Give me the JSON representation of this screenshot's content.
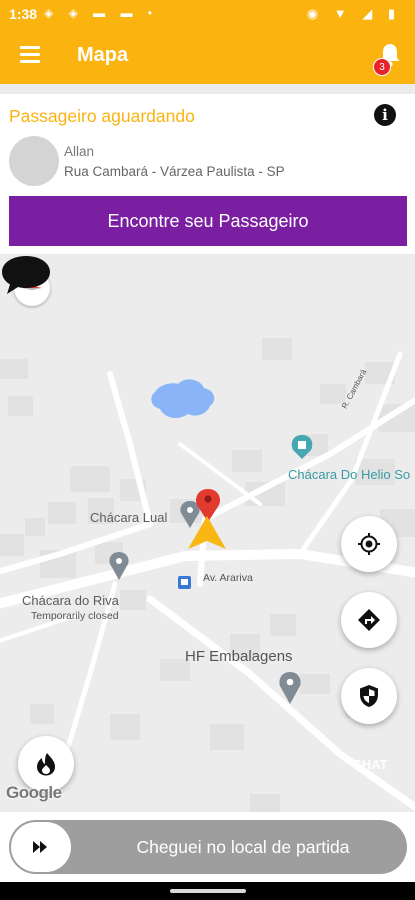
{
  "status_bar": {
    "time": "1:38",
    "left_icons": "◈ ◈ ▬ ▬ •",
    "right_icons": "◉ ▼ ◢ ▮"
  },
  "app_bar": {
    "title": "Mapa",
    "notification_count": "3"
  },
  "ride_card": {
    "status": "Passageiro aguardando",
    "info_glyph": "i",
    "passenger_name": "Allan",
    "passenger_address": "Rua Cambará - Várzea Paulista - SP",
    "find_button": "Encontre seu Passageiro"
  },
  "map": {
    "labels": {
      "chacara_helio": "Chácara Do Helio So",
      "chacara_lual": "Chácara Lual",
      "av_arariva": "Av. Arariva",
      "chacara_riva": "Chácara do Riva",
      "temporarily_closed": "Temporarily closed",
      "hf_embalagens": "HF Embalagens",
      "street_small": "R. Cambará"
    },
    "attribution": "Google",
    "chat_label": "CHAT"
  },
  "bottom": {
    "slider_text": "Cheguei no local de partida"
  },
  "colors": {
    "primary": "#fbb310",
    "accent_purple": "#7b1fa2",
    "badge_red": "#e8212b"
  }
}
